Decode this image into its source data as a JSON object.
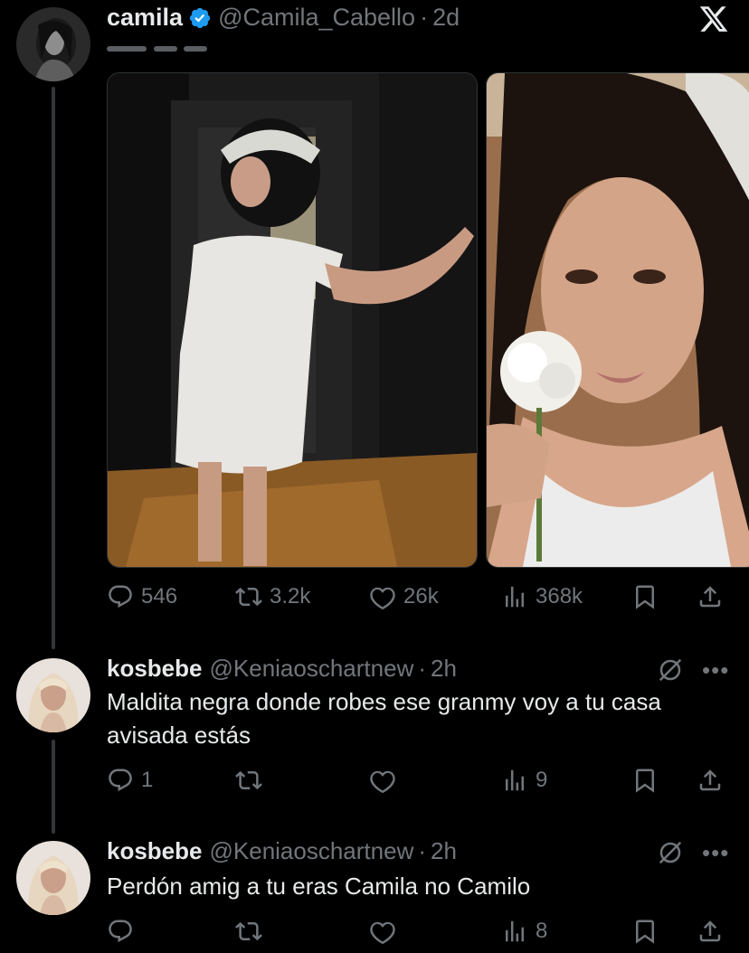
{
  "main_tweet": {
    "name": "camila",
    "handle": "@Camila_Cabello",
    "time": "2d",
    "stats": {
      "replies": "546",
      "reposts": "3.2k",
      "likes": "26k",
      "views": "368k"
    }
  },
  "replies": [
    {
      "name": "kosbebe",
      "handle": "@Keniaoschartnew",
      "time": "2h",
      "text": "Maldita negra donde robes ese granmy voy a tu casa avisada estás",
      "stats": {
        "replies": "1",
        "reposts": "",
        "likes": "",
        "views": "9"
      }
    },
    {
      "name": "kosbebe",
      "handle": "@Keniaoschartnew",
      "time": "2h",
      "text": "Perdón amig a tu eras Camila no Camilo",
      "stats": {
        "replies": "",
        "reposts": "",
        "likes": "",
        "views": "8"
      }
    }
  ],
  "colors": {
    "background": "#000000",
    "text": "#e7e9ea",
    "secondary": "#71767b",
    "verified": "#1d9bf0"
  },
  "icons": [
    "x-logo-icon",
    "verified-badge-icon",
    "reply-icon",
    "repost-icon",
    "like-icon",
    "views-icon",
    "bookmark-icon",
    "share-icon",
    "mute-icon",
    "more-icon"
  ]
}
